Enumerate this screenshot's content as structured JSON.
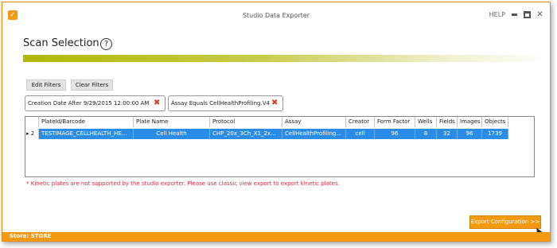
{
  "app": {
    "title": "Studio Data Exporter",
    "help_label": "HELP",
    "icon": "app-logo-icon"
  },
  "window_controls": {
    "minimize_icon": "minimize-icon",
    "maximize_icon": "maximize-icon",
    "close_icon": "close-icon"
  },
  "page": {
    "heading": "Scan Selection",
    "help_glyph": "?"
  },
  "toolbar": {
    "edit_filters_label": "Edit Filters",
    "clear_filters_label": "Clear Filters"
  },
  "filters": [
    {
      "label": "Creation Date After 9/29/2015 12:00:00 AM",
      "remove_icon": "remove-filter-icon"
    },
    {
      "label": "Assay Equals CellHealthProfiling.V4",
      "remove_icon": "remove-filter-icon"
    }
  ],
  "grid": {
    "columns": [
      "PlateId/Barcode",
      "Plate Name",
      "Protocol",
      "Assay",
      "Creator",
      "Form Factor",
      "Wells",
      "Fields",
      "Images",
      "Objects"
    ],
    "rows": [
      {
        "indicator": "2",
        "plate_id": "TESTIMAGE_CELLHEALTH_HE...",
        "plate_name": "Cell Health",
        "protocol": "CHP_20x_3Ch_X1_2x...",
        "assay": "CellHealthProfiling...",
        "creator": "cell",
        "form_factor": "96",
        "wells": "8",
        "fields": "32",
        "images": "96",
        "objects": "1739"
      }
    ]
  },
  "note": "* Kinetic plates are not supported by the studio exporter. Please use classic view export to export kinetic plates.",
  "export_button_label": "Export Configuration >>",
  "status": {
    "store_label": "Store:  STORE"
  },
  "colors": {
    "accent": "#f39a12",
    "selection": "#2b8ce8",
    "warning_text": "#e0283c",
    "gradient_start": "#b0b800"
  }
}
